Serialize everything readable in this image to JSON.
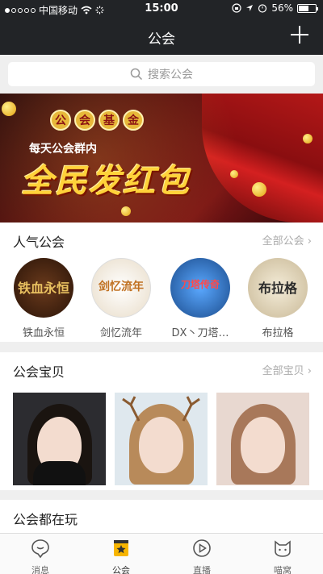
{
  "status": {
    "carrier": "中国移动",
    "time": "15:00",
    "battery": "56%"
  },
  "nav": {
    "title": "公会"
  },
  "search": {
    "placeholder": "搜索公会"
  },
  "banner": {
    "fund_chars": [
      "公",
      "会",
      "基",
      "金"
    ],
    "subtitle": "每天公会群内",
    "headline": "全民发红包"
  },
  "popular": {
    "title": "人气公会",
    "more": "全部公会 ›",
    "items": [
      {
        "name": "铁血永恒",
        "avatar_text": "铁血永恒"
      },
      {
        "name": "剑忆流年",
        "avatar_text": "剑忆流年"
      },
      {
        "name": "DX丶刀塔…",
        "avatar_text": "刀塔传奇"
      },
      {
        "name": "布拉格",
        "avatar_text": "布拉格"
      }
    ]
  },
  "babies": {
    "title": "公会宝贝",
    "more": "全部宝贝 ›"
  },
  "playing": {
    "title": "公会都在玩"
  },
  "tabs": [
    {
      "label": "消息",
      "icon": "message-icon",
      "active": false
    },
    {
      "label": "公会",
      "icon": "guild-icon",
      "active": true
    },
    {
      "label": "直播",
      "icon": "play-icon",
      "active": false
    },
    {
      "label": "喵窝",
      "icon": "cat-icon",
      "active": false
    }
  ],
  "colors": {
    "accent": "#f7b500",
    "navbar": "#222427"
  }
}
